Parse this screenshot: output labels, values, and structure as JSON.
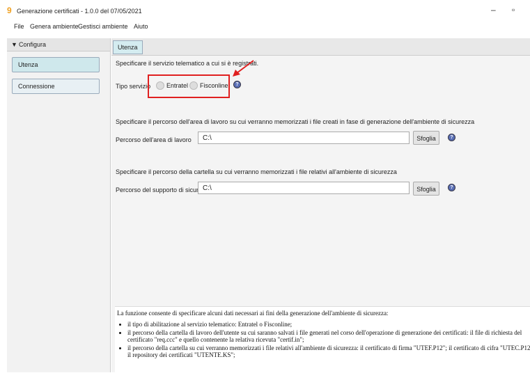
{
  "window": {
    "icon": "9",
    "title": "Generazione certificati - 1.0.0 del 07/05/2021",
    "minimize": "–",
    "maximize": "▫"
  },
  "menu": [
    "File",
    "Genera ambiente",
    "Gestisci ambiente",
    "Aiuto"
  ],
  "sidebar": {
    "header": "Configura",
    "items": [
      {
        "label": "Utenza"
      },
      {
        "label": "Connessione"
      }
    ]
  },
  "tab": {
    "label": "Utenza"
  },
  "section1": {
    "instruction": "Specificare il servizio telematico a cui si è registrati.",
    "field_label": "Tipo servizio",
    "options": [
      "Entratel",
      "Fisconline"
    ]
  },
  "section2": {
    "instruction": "Specificare il percorso dell'area di lavoro su cui verranno memorizzati i file creati in fase di generazione dell'ambiente di sicurezza",
    "field_label": "Percorso dell'area di lavoro",
    "value": "C:\\",
    "browse": "Sfoglia"
  },
  "section3": {
    "instruction": "Specificare il percorso della cartella su cui verranno memorizzati i file relativi all'ambiente di sicurezza",
    "field_label": "Percorso del supporto di sicur...",
    "value": "C:\\",
    "browse": "Sfoglia"
  },
  "description": {
    "intro": "La funzione consente di specificare alcuni dati necessari ai fini della generazione dell'ambiente di sicurezza:",
    "bullets": [
      "il tipo di abilitazione al servizio telematico: Entratel o Fisconline;",
      "il percorso della cartella di lavoro dell'utente su cui saranno salvati i file generati nel corso dell'operazione di generazione dei certificati: il file di richiesta del certificato \"req.ccc\" e quello contenente la relativa ricevuta \"certif.in\";",
      "il percorso della cartella su cui verranno memorizzati i file relativi all'ambiente di sicurezza: il certificato di firma \"UTEF.P12\"; il certificato di cifra \"UTEC.P12\"; il repository dei certificati \"UTENTE.KS\";"
    ]
  },
  "icons": {
    "help": "help-circle-icon",
    "collapse": "triangle-down-icon"
  },
  "colors": {
    "accent_tab": "#d4ecf0",
    "highlight_border": "#e02020",
    "app_icon": "#f0a020"
  }
}
